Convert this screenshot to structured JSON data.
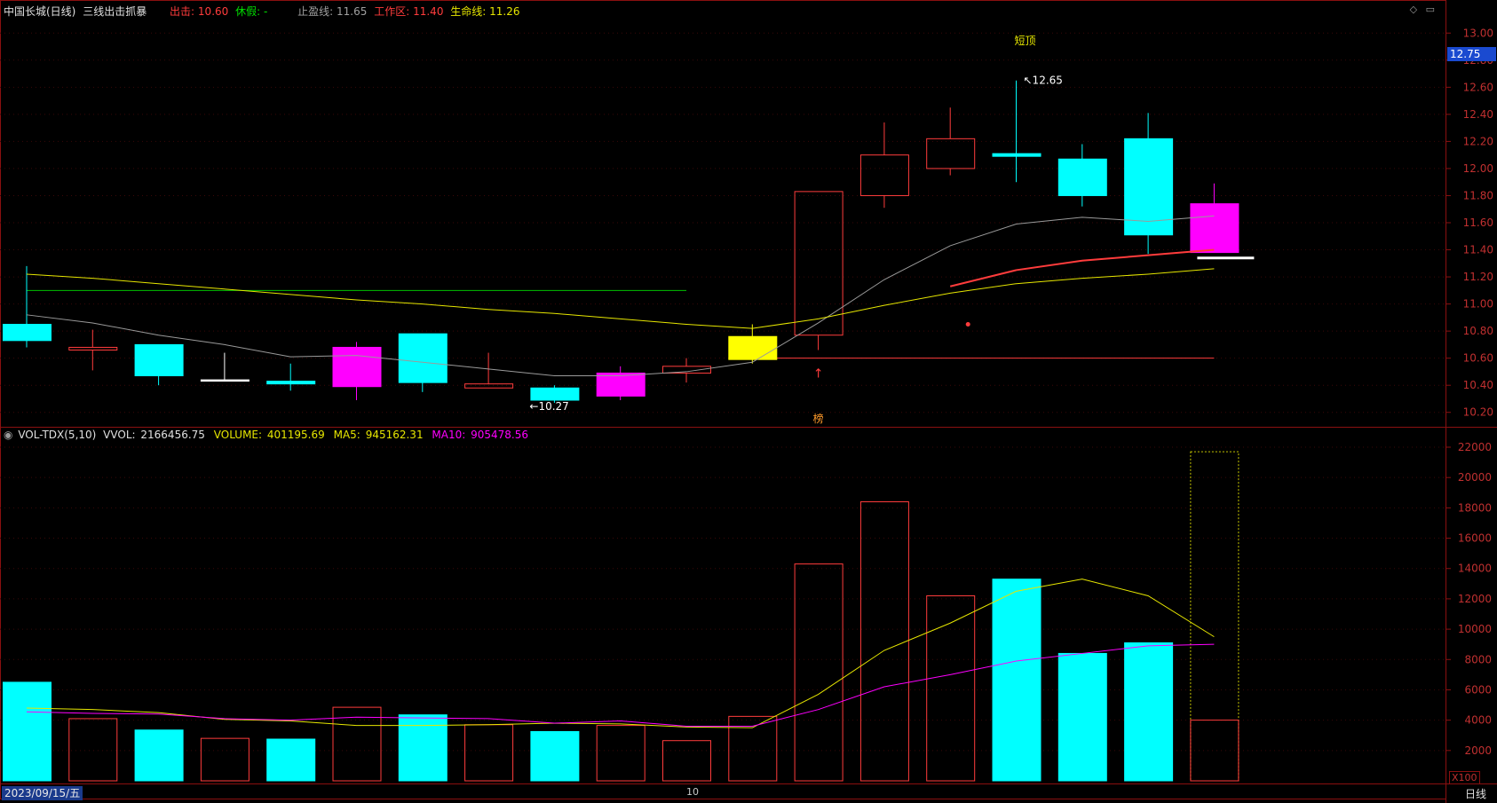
{
  "header": {
    "stock": "中国长城(日线)",
    "indicator": "三线出击抓暴",
    "chuji_label": "出击:",
    "chuji_value": "10.60",
    "xiujia_label": "休假:",
    "xiujia_value": "-",
    "stop_label": "止盈线:",
    "stop_value": "11.65",
    "work_label": "工作区:",
    "work_value": "11.40",
    "life_label": "生命线:",
    "life_value": "11.26"
  },
  "top_icons": [
    "◇",
    "▭"
  ],
  "current_price": "12.75",
  "price_axis_labels": [
    "13.00",
    "12.80",
    "12.60",
    "12.40",
    "12.20",
    "12.00",
    "11.80",
    "11.60",
    "11.40",
    "11.20",
    "11.00",
    "10.80",
    "10.60",
    "10.40",
    "10.20"
  ],
  "annotations": {
    "short_top": "短顶",
    "high_label": "12.65",
    "low_label": "10.27",
    "bang": "榜"
  },
  "volume_header": {
    "name": "VOL-TDX(5,10)",
    "vvol_label": "VVOL:",
    "vvol_value": "2166456.75",
    "volume_label": "VOLUME:",
    "volume_value": "401195.69",
    "ma5_label": "MA5:",
    "ma5_value": "945162.31",
    "ma10_label": "MA10:",
    "ma10_value": "905478.56"
  },
  "volume_axis_labels": [
    "22000",
    "20000",
    "18000",
    "16000",
    "14000",
    "12000",
    "10000",
    "8000",
    "6000",
    "4000",
    "2000"
  ],
  "volume_unit": "X100",
  "footer": {
    "date": "2023/09/15/五",
    "tick": "10",
    "period": "日线"
  },
  "colors": {
    "up": "#ff3c3c",
    "down": "#00ffff",
    "ma_gray": "#9a9a9a",
    "ma_yellow": "#e6e600",
    "ma5": "#e6e600",
    "ma10": "#ff00ff",
    "magenta": "#ff00ff",
    "signal": "#ffff00"
  },
  "chart_data": {
    "type": "candlestick",
    "price_ylim": [
      10.1,
      13.1
    ],
    "volume_ylim": [
      0,
      22000
    ],
    "candles": [
      {
        "o": 10.85,
        "c": 10.73,
        "h": 11.28,
        "l": 10.68,
        "vol": 6500,
        "color": "cyan"
      },
      {
        "o": 10.66,
        "c": 10.68,
        "h": 10.81,
        "l": 10.51,
        "vol": 4100,
        "color": "red"
      },
      {
        "o": 10.7,
        "c": 10.47,
        "h": 10.7,
        "l": 10.4,
        "vol": 3350,
        "color": "cyan"
      },
      {
        "o": 10.44,
        "c": 10.44,
        "h": 10.64,
        "l": 10.44,
        "vol": 2800,
        "color": "white"
      },
      {
        "o": 10.43,
        "c": 10.41,
        "h": 10.56,
        "l": 10.36,
        "vol": 2750,
        "color": "cyan"
      },
      {
        "o": 10.39,
        "c": 10.68,
        "h": 10.72,
        "l": 10.29,
        "vol": 4850,
        "color": "magenta"
      },
      {
        "o": 10.78,
        "c": 10.42,
        "h": 10.78,
        "l": 10.35,
        "vol": 4350,
        "color": "cyan"
      },
      {
        "o": 10.38,
        "c": 10.41,
        "h": 10.64,
        "l": 10.38,
        "vol": 3700,
        "color": "red"
      },
      {
        "o": 10.38,
        "c": 10.29,
        "h": 10.4,
        "l": 10.27,
        "vol": 3250,
        "color": "cyan"
      },
      {
        "o": 10.32,
        "c": 10.49,
        "h": 10.54,
        "l": 10.29,
        "vol": 3650,
        "color": "magenta"
      },
      {
        "o": 10.49,
        "c": 10.54,
        "h": 10.6,
        "l": 10.42,
        "vol": 2650,
        "color": "red"
      },
      {
        "o": 10.59,
        "c": 10.76,
        "h": 10.85,
        "l": 10.56,
        "vol": 4250,
        "color": "yellow"
      },
      {
        "o": 10.77,
        "c": 11.83,
        "h": 11.83,
        "l": 10.66,
        "vol": 14300,
        "color": "red"
      },
      {
        "o": 11.8,
        "c": 12.1,
        "h": 12.34,
        "l": 11.71,
        "vol": 18400,
        "color": "red"
      },
      {
        "o": 12.0,
        "c": 12.22,
        "h": 12.45,
        "l": 11.95,
        "vol": 12200,
        "color": "red"
      },
      {
        "o": 12.11,
        "c": 12.09,
        "h": 12.65,
        "l": 11.9,
        "vol": 13300,
        "color": "cyan"
      },
      {
        "o": 12.07,
        "c": 11.8,
        "h": 12.18,
        "l": 11.72,
        "vol": 8400,
        "color": "cyan"
      },
      {
        "o": 12.22,
        "c": 11.51,
        "h": 12.41,
        "l": 11.37,
        "vol": 9100,
        "color": "cyan"
      },
      {
        "o": 11.38,
        "c": 11.74,
        "h": 11.89,
        "l": 11.38,
        "vol": 4000,
        "vol_outline": 21700,
        "color": "magenta"
      }
    ],
    "ma_gray": [
      10.92,
      10.86,
      10.77,
      10.7,
      10.61,
      10.62,
      10.57,
      10.52,
      10.47,
      10.47,
      10.5,
      10.57,
      10.86,
      11.18,
      11.43,
      11.59,
      11.64,
      11.61,
      11.65
    ],
    "ma_yellow": [
      11.22,
      11.19,
      11.15,
      11.11,
      11.07,
      11.03,
      11.0,
      10.96,
      10.93,
      10.89,
      10.85,
      10.82,
      10.89,
      10.99,
      11.08,
      11.15,
      11.19,
      11.22,
      11.26
    ],
    "ma_red_from": 14,
    "ma_red": [
      11.13,
      11.25,
      11.32,
      11.36,
      11.4
    ],
    "green_level": 11.1,
    "red_level": 10.6,
    "white_level": 11.34,
    "vol_ma5": [
      4800,
      4700,
      4500,
      4050,
      3950,
      3650,
      3650,
      3700,
      3800,
      3750,
      3550,
      3500,
      5700,
      8600,
      10400,
      12500,
      13300,
      12200,
      9500
    ],
    "vol_ma10": [
      4550,
      4450,
      4400,
      4100,
      4000,
      4200,
      4150,
      4100,
      3800,
      3950,
      3600,
      3600,
      4700,
      6200,
      7000,
      7900,
      8400,
      8900,
      9000
    ]
  }
}
